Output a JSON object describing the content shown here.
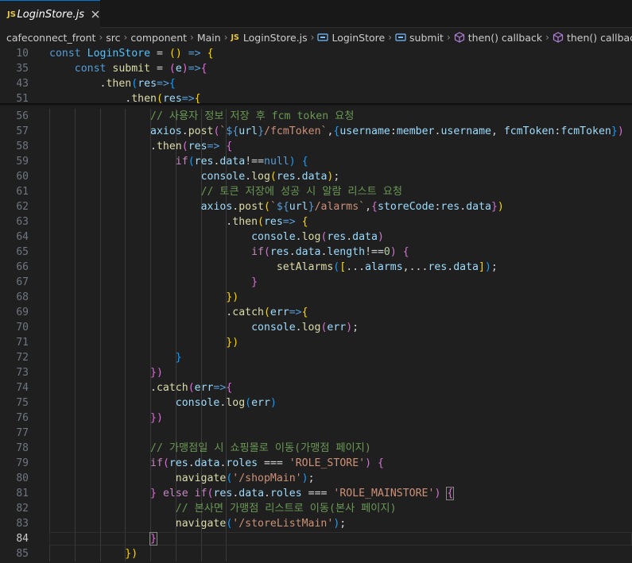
{
  "tab": {
    "icon": "JS",
    "title": "LoginStore.js",
    "close_icon": "close-icon"
  },
  "breadcrumb": {
    "items": [
      "cafeconnect_front",
      "src",
      "component",
      "Main",
      "LoginStore.js",
      "LoginStore",
      "submit",
      "then() callback",
      "then() callback"
    ],
    "file_icon": "JS"
  },
  "colors": {
    "accent": "#0078d4",
    "js_icon": "#e7c547",
    "background": "#1f1f1f"
  },
  "lines": [
    {
      "n": "10",
      "segs": [
        [
          "kw",
          "const "
        ],
        [
          "cst",
          "LoginStore"
        ],
        [
          "op",
          " = "
        ],
        [
          "b1",
          "()"
        ],
        [
          "op",
          " "
        ],
        [
          "kw",
          "=>"
        ],
        [
          "op",
          " "
        ],
        [
          "b1",
          "{"
        ]
      ]
    },
    {
      "n": "35",
      "segs": [
        [
          "op",
          "    "
        ],
        [
          "kw",
          "const "
        ],
        [
          "fn",
          "submit"
        ],
        [
          "op",
          " = "
        ],
        [
          "b2",
          "("
        ],
        [
          "var",
          "e"
        ],
        [
          "b2",
          ")"
        ],
        [
          "kw",
          "=>"
        ],
        [
          "b2",
          "{"
        ]
      ]
    },
    {
      "n": "43",
      "segs": [
        [
          "op",
          "        ."
        ],
        [
          "fn",
          "then"
        ],
        [
          "b3",
          "("
        ],
        [
          "var",
          "res"
        ],
        [
          "kw",
          "=>"
        ],
        [
          "b3",
          "{"
        ]
      ]
    },
    {
      "n": "51",
      "segs": [
        [
          "op",
          "            ."
        ],
        [
          "fn",
          "then"
        ],
        [
          "b1",
          "("
        ],
        [
          "var",
          "res"
        ],
        [
          "kw",
          "=>"
        ],
        [
          "b1",
          "{"
        ]
      ]
    },
    {
      "n": "56",
      "segs": [
        [
          "op",
          "                "
        ],
        [
          "cm",
          "// 사용자 정보 저장 후 fcm token 요청"
        ]
      ]
    },
    {
      "n": "57",
      "segs": [
        [
          "op",
          "                "
        ],
        [
          "var",
          "axios"
        ],
        [
          "op",
          "."
        ],
        [
          "fn",
          "post"
        ],
        [
          "b2",
          "("
        ],
        [
          "str",
          "`"
        ],
        [
          "tpl",
          "${"
        ],
        [
          "var",
          "url"
        ],
        [
          "tpl",
          "}"
        ],
        [
          "str",
          "/fcmToken`"
        ],
        [
          "op",
          ","
        ],
        [
          "b3",
          "{"
        ],
        [
          "var",
          "username"
        ],
        [
          "op",
          ":"
        ],
        [
          "var",
          "member"
        ],
        [
          "op",
          "."
        ],
        [
          "var",
          "username"
        ],
        [
          "op",
          ", "
        ],
        [
          "var",
          "fcmToken"
        ],
        [
          "op",
          ":"
        ],
        [
          "var",
          "fcmToken"
        ],
        [
          "b3",
          "}"
        ],
        [
          "b2",
          ")"
        ]
      ]
    },
    {
      "n": "58",
      "segs": [
        [
          "op",
          "                ."
        ],
        [
          "fn",
          "then"
        ],
        [
          "b2",
          "("
        ],
        [
          "var",
          "res"
        ],
        [
          "kw",
          "=>"
        ],
        [
          "op",
          " "
        ],
        [
          "b2",
          "{"
        ]
      ]
    },
    {
      "n": "59",
      "segs": [
        [
          "op",
          "                    "
        ],
        [
          "ctl",
          "if"
        ],
        [
          "b3",
          "("
        ],
        [
          "var",
          "res"
        ],
        [
          "op",
          "."
        ],
        [
          "var",
          "data"
        ],
        [
          "op",
          "!=="
        ],
        [
          "kw",
          "null"
        ],
        [
          "b3",
          ")"
        ],
        [
          "op",
          " "
        ],
        [
          "b3",
          "{"
        ]
      ]
    },
    {
      "n": "60",
      "segs": [
        [
          "op",
          "                        "
        ],
        [
          "var",
          "console"
        ],
        [
          "op",
          "."
        ],
        [
          "fn",
          "log"
        ],
        [
          "b1",
          "("
        ],
        [
          "var",
          "res"
        ],
        [
          "op",
          "."
        ],
        [
          "var",
          "data"
        ],
        [
          "b1",
          ")"
        ],
        [
          "op",
          ";"
        ]
      ]
    },
    {
      "n": "61",
      "segs": [
        [
          "op",
          "                        "
        ],
        [
          "cm",
          "// 토큰 저장에 성공 시 알람 리스트 요청"
        ]
      ]
    },
    {
      "n": "62",
      "segs": [
        [
          "op",
          "                        "
        ],
        [
          "var",
          "axios"
        ],
        [
          "op",
          "."
        ],
        [
          "fn",
          "post"
        ],
        [
          "b1",
          "("
        ],
        [
          "str",
          "`"
        ],
        [
          "tpl",
          "${"
        ],
        [
          "var",
          "url"
        ],
        [
          "tpl",
          "}"
        ],
        [
          "str",
          "/alarms`"
        ],
        [
          "op",
          ","
        ],
        [
          "b2",
          "{"
        ],
        [
          "var",
          "storeCode"
        ],
        [
          "op",
          ":"
        ],
        [
          "var",
          "res"
        ],
        [
          "op",
          "."
        ],
        [
          "var",
          "data"
        ],
        [
          "b2",
          "}"
        ],
        [
          "b1",
          ")"
        ]
      ]
    },
    {
      "n": "63",
      "segs": [
        [
          "op",
          "                            ."
        ],
        [
          "fn",
          "then"
        ],
        [
          "b1",
          "("
        ],
        [
          "var",
          "res"
        ],
        [
          "kw",
          "=>"
        ],
        [
          "op",
          " "
        ],
        [
          "b1",
          "{"
        ]
      ]
    },
    {
      "n": "64",
      "segs": [
        [
          "op",
          "                                "
        ],
        [
          "var",
          "console"
        ],
        [
          "op",
          "."
        ],
        [
          "fn",
          "log"
        ],
        [
          "b2",
          "("
        ],
        [
          "var",
          "res"
        ],
        [
          "op",
          "."
        ],
        [
          "var",
          "data"
        ],
        [
          "b2",
          ")"
        ]
      ]
    },
    {
      "n": "65",
      "segs": [
        [
          "op",
          "                                "
        ],
        [
          "ctl",
          "if"
        ],
        [
          "b2",
          "("
        ],
        [
          "var",
          "res"
        ],
        [
          "op",
          "."
        ],
        [
          "var",
          "data"
        ],
        [
          "op",
          "."
        ],
        [
          "var",
          "length"
        ],
        [
          "op",
          "!=="
        ],
        [
          "num",
          "0"
        ],
        [
          "b2",
          ")"
        ],
        [
          "op",
          " "
        ],
        [
          "b2",
          "{"
        ]
      ]
    },
    {
      "n": "66",
      "segs": [
        [
          "op",
          "                                    "
        ],
        [
          "fn",
          "setAlarms"
        ],
        [
          "b3",
          "("
        ],
        [
          "b1",
          "["
        ],
        [
          "op",
          "..."
        ],
        [
          "var",
          "alarms"
        ],
        [
          "op",
          ",..."
        ],
        [
          "var",
          "res"
        ],
        [
          "op",
          "."
        ],
        [
          "var",
          "data"
        ],
        [
          "b1",
          "]"
        ],
        [
          "b3",
          ")"
        ],
        [
          "op",
          ";"
        ]
      ]
    },
    {
      "n": "67",
      "segs": [
        [
          "op",
          "                                "
        ],
        [
          "b2",
          "}"
        ]
      ]
    },
    {
      "n": "68",
      "segs": [
        [
          "op",
          "                            "
        ],
        [
          "b1",
          "})"
        ]
      ]
    },
    {
      "n": "69",
      "segs": [
        [
          "op",
          "                            ."
        ],
        [
          "fn",
          "catch"
        ],
        [
          "b1",
          "("
        ],
        [
          "var",
          "err"
        ],
        [
          "kw",
          "=>"
        ],
        [
          "b1",
          "{"
        ]
      ]
    },
    {
      "n": "70",
      "segs": [
        [
          "op",
          "                                "
        ],
        [
          "var",
          "console"
        ],
        [
          "op",
          "."
        ],
        [
          "fn",
          "log"
        ],
        [
          "b2",
          "("
        ],
        [
          "var",
          "err"
        ],
        [
          "b2",
          ")"
        ],
        [
          "op",
          ";"
        ]
      ]
    },
    {
      "n": "71",
      "segs": [
        [
          "op",
          "                            "
        ],
        [
          "b1",
          "})"
        ]
      ]
    },
    {
      "n": "72",
      "segs": [
        [
          "op",
          "                    "
        ],
        [
          "b3",
          "}"
        ]
      ]
    },
    {
      "n": "73",
      "segs": [
        [
          "op",
          "                "
        ],
        [
          "b2",
          "})"
        ]
      ]
    },
    {
      "n": "74",
      "segs": [
        [
          "op",
          "                ."
        ],
        [
          "fn",
          "catch"
        ],
        [
          "b2",
          "("
        ],
        [
          "var",
          "err"
        ],
        [
          "kw",
          "=>"
        ],
        [
          "b2",
          "{"
        ]
      ]
    },
    {
      "n": "75",
      "segs": [
        [
          "op",
          "                    "
        ],
        [
          "var",
          "console"
        ],
        [
          "op",
          "."
        ],
        [
          "fn",
          "log"
        ],
        [
          "b3",
          "("
        ],
        [
          "var",
          "err"
        ],
        [
          "b3",
          ")"
        ]
      ]
    },
    {
      "n": "76",
      "segs": [
        [
          "op",
          "                "
        ],
        [
          "b2",
          "})"
        ]
      ]
    },
    {
      "n": "77",
      "segs": []
    },
    {
      "n": "78",
      "segs": [
        [
          "op",
          "                "
        ],
        [
          "cm",
          "// 가맹점일 시 쇼핑몰로 이동(가맹점 페이지)"
        ]
      ]
    },
    {
      "n": "79",
      "segs": [
        [
          "op",
          "                "
        ],
        [
          "ctl",
          "if"
        ],
        [
          "b2",
          "("
        ],
        [
          "var",
          "res"
        ],
        [
          "op",
          "."
        ],
        [
          "var",
          "data"
        ],
        [
          "op",
          "."
        ],
        [
          "var",
          "roles"
        ],
        [
          "op",
          " === "
        ],
        [
          "str",
          "'ROLE_STORE'"
        ],
        [
          "b2",
          ")"
        ],
        [
          "op",
          " "
        ],
        [
          "b2",
          "{"
        ]
      ]
    },
    {
      "n": "80",
      "segs": [
        [
          "op",
          "                    "
        ],
        [
          "fn",
          "navigate"
        ],
        [
          "b3",
          "("
        ],
        [
          "str",
          "'/shopMain'"
        ],
        [
          "b3",
          ")"
        ],
        [
          "op",
          ";"
        ]
      ]
    },
    {
      "n": "81",
      "segs": [
        [
          "op",
          "                "
        ],
        [
          "b2",
          "}"
        ],
        [
          "op",
          " "
        ],
        [
          "ctl",
          "else if"
        ],
        [
          "b2",
          "("
        ],
        [
          "var",
          "res"
        ],
        [
          "op",
          "."
        ],
        [
          "var",
          "data"
        ],
        [
          "op",
          "."
        ],
        [
          "var",
          "roles"
        ],
        [
          "op",
          " === "
        ],
        [
          "str",
          "'ROLE_MAINSTORE'"
        ],
        [
          "b2",
          ")"
        ],
        [
          "op",
          " "
        ],
        [
          "b2bm",
          "{"
        ]
      ]
    },
    {
      "n": "82",
      "segs": [
        [
          "op",
          "                    "
        ],
        [
          "cm",
          "// 본사면 가맹점 리스트로 이동(본사 페이지)"
        ]
      ]
    },
    {
      "n": "83",
      "segs": [
        [
          "op",
          "                    "
        ],
        [
          "fn",
          "navigate"
        ],
        [
          "b3",
          "("
        ],
        [
          "str",
          "'/storeListMain'"
        ],
        [
          "b3",
          ")"
        ],
        [
          "op",
          ";"
        ]
      ]
    },
    {
      "n": "84",
      "segs": [
        [
          "op",
          "                "
        ],
        [
          "b2bm",
          "}"
        ]
      ]
    },
    {
      "n": "85",
      "segs": [
        [
          "op",
          "            "
        ],
        [
          "b1",
          "})"
        ]
      ]
    }
  ]
}
